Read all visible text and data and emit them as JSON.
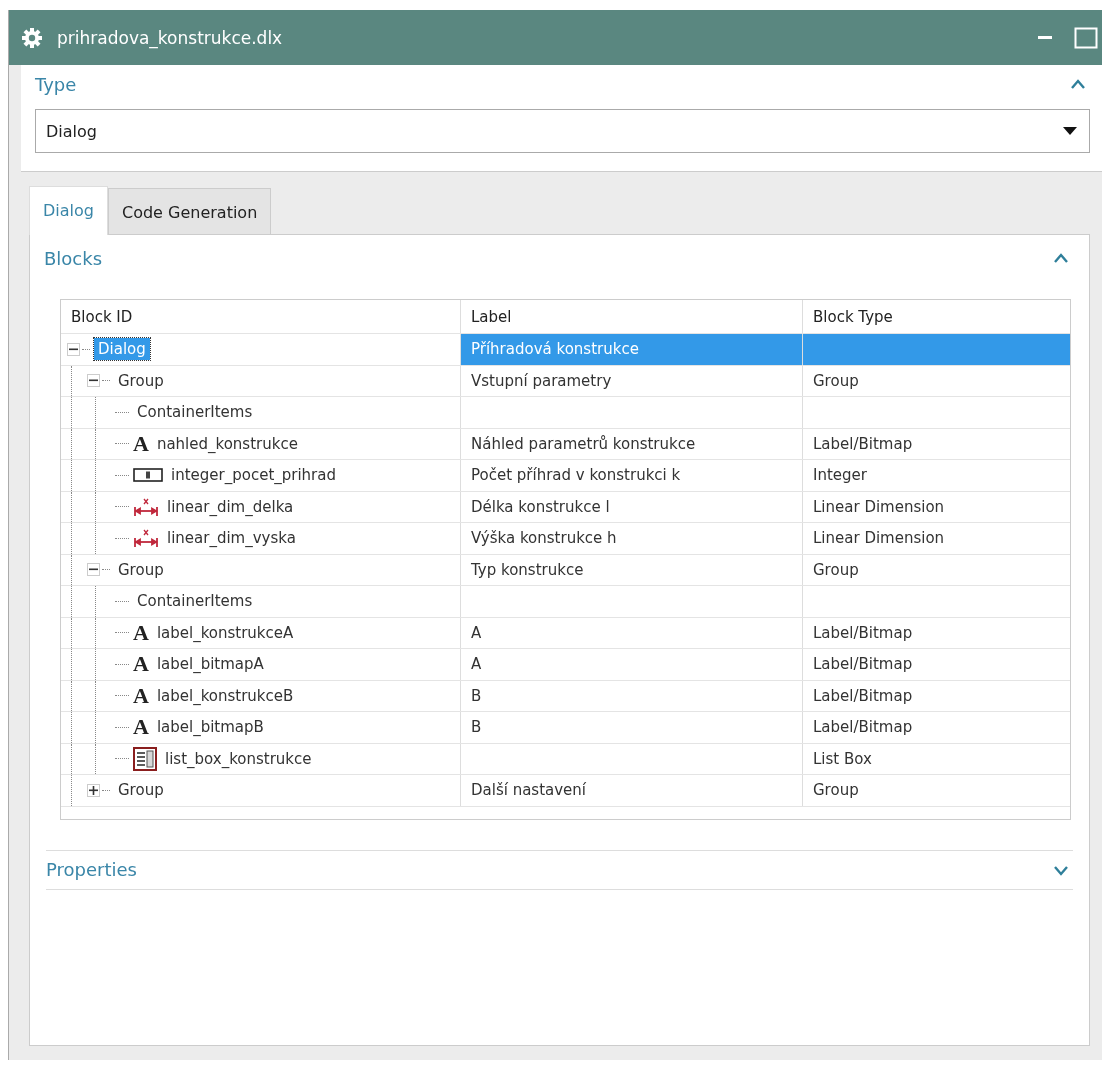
{
  "window": {
    "title": "prihradova_konstrukce.dlx"
  },
  "type_section": {
    "title": "Type",
    "expanded": true,
    "value": "Dialog"
  },
  "tabs": [
    {
      "label": "Dialog",
      "selected": true
    },
    {
      "label": "Code Generation",
      "selected": false
    }
  ],
  "blocks_section": {
    "title": "Blocks",
    "expanded": true
  },
  "table": {
    "columns": [
      "Block ID",
      "Label",
      "Block Type"
    ],
    "rows": [
      {
        "id": "Dialog",
        "label": "Příhradová konstrukce",
        "selected": true,
        "expanded": true,
        "children": [
          {
            "id": "Group",
            "label": "Vstupní parametry",
            "type": "Group",
            "selected": false,
            "expanded": true,
            "children": [
              {
                "id": "ContainerItems",
                "selected": false
              },
              {
                "id": "nahled_konstrukce",
                "kind": "label",
                "glyph": "A",
                "label": "Náhled parametrů konstrukce",
                "type": "Label/Bitmap",
                "selected": false
              },
              {
                "id": "integer_pocet_prihrad",
                "kind": "integer",
                "label": "Počet příhrad v konstrukci  k",
                "type": "Integer",
                "selected": false
              },
              {
                "id": "linear_dim_delka",
                "kind": "linear_dim",
                "label": "Délka konstrukce l",
                "type": "Linear Dimension",
                "selected": false
              },
              {
                "id": "linear_dim_vyska",
                "kind": "linear_dim",
                "label": "Výška konstrukce h",
                "type": "Linear Dimension",
                "selected": false
              }
            ]
          },
          {
            "id": "Group",
            "label": "Typ konstrukce",
            "type": "Group",
            "selected": false,
            "expanded": true,
            "children": [
              {
                "id": "ContainerItems",
                "selected": false
              },
              {
                "id": "label_konstrukceA",
                "kind": "label",
                "glyph": "A",
                "label": "A",
                "type": "Label/Bitmap",
                "selected": false
              },
              {
                "id": "label_bitmapA",
                "kind": "label",
                "glyph": "A",
                "label": "A",
                "type": "Label/Bitmap",
                "selected": false
              },
              {
                "id": "label_konstrukceB",
                "kind": "label",
                "glyph": "A",
                "label": "B",
                "type": "Label/Bitmap",
                "selected": false
              },
              {
                "id": "label_bitmapB",
                "kind": "label",
                "glyph": "A",
                "label": "B",
                "type": "Label/Bitmap",
                "selected": false
              },
              {
                "id": "list_box_konstrukce",
                "kind": "list_box",
                "type": "List Box",
                "selected": false
              }
            ]
          },
          {
            "id": "Group",
            "label": "Další nastavení",
            "type": "Group",
            "selected": false,
            "expanded": false
          }
        ]
      }
    ]
  },
  "properties_section": {
    "title": "Properties",
    "expanded": false
  }
}
